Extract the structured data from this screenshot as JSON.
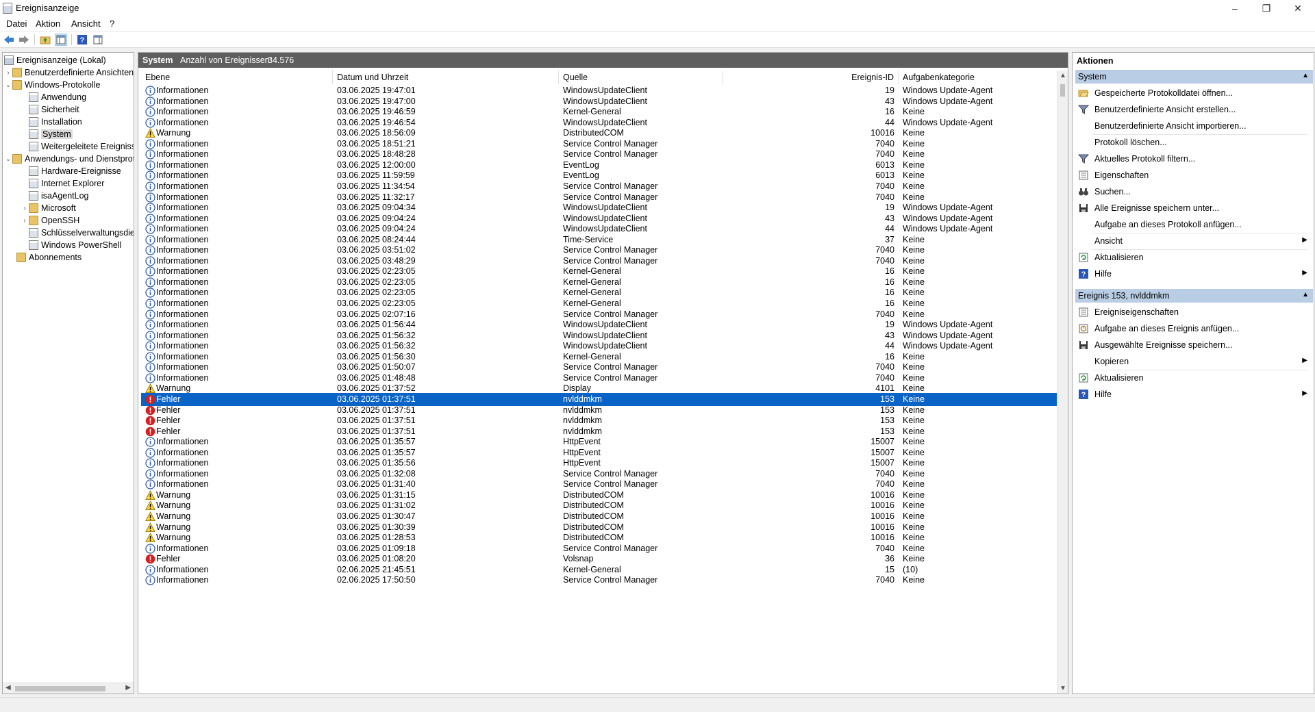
{
  "window": {
    "title": "Ereignisanzeige"
  },
  "menubar": [
    "Datei",
    "Aktion",
    "Ansicht",
    "?"
  ],
  "tree": {
    "root": "Ereignisanzeige (Lokal)",
    "custom_views": "Benutzerdefinierte Ansichten",
    "windows_logs": "Windows-Protokolle",
    "windows_logs_items": [
      "Anwendung",
      "Sicherheit",
      "Installation",
      "System",
      "Weitergeleitete Ereignisse"
    ],
    "apps_services": "Anwendungs- und Dienstprotokolle",
    "apps_items": [
      "Hardware-Ereignisse",
      "Internet Explorer",
      "isaAgentLog",
      "Microsoft",
      "OpenSSH",
      "Schlüsselverwaltungsdienst",
      "Windows PowerShell"
    ],
    "subscriptions": "Abonnements"
  },
  "center": {
    "log_name": "System",
    "count_label": "Anzahl von Ereignissen:",
    "count_value": "34.576",
    "columns": [
      "Ebene",
      "Datum und Uhrzeit",
      "Quelle",
      "Ereignis-ID",
      "Aufgabenkategorie"
    ],
    "rows": [
      {
        "level": "Informationen",
        "date": "03.06.2025 19:47:01",
        "source": "WindowsUpdateClient",
        "id": "19",
        "cat": "Windows Update-Agent"
      },
      {
        "level": "Informationen",
        "date": "03.06.2025 19:47:00",
        "source": "WindowsUpdateClient",
        "id": "43",
        "cat": "Windows Update-Agent"
      },
      {
        "level": "Informationen",
        "date": "03.06.2025 19:46:59",
        "source": "Kernel-General",
        "id": "16",
        "cat": "Keine"
      },
      {
        "level": "Informationen",
        "date": "03.06.2025 19:46:54",
        "source": "WindowsUpdateClient",
        "id": "44",
        "cat": "Windows Update-Agent"
      },
      {
        "level": "Warnung",
        "date": "03.06.2025 18:56:09",
        "source": "DistributedCOM",
        "id": "10016",
        "cat": "Keine"
      },
      {
        "level": "Informationen",
        "date": "03.06.2025 18:51:21",
        "source": "Service Control Manager",
        "id": "7040",
        "cat": "Keine"
      },
      {
        "level": "Informationen",
        "date": "03.06.2025 18:48:28",
        "source": "Service Control Manager",
        "id": "7040",
        "cat": "Keine"
      },
      {
        "level": "Informationen",
        "date": "03.06.2025 12:00:00",
        "source": "EventLog",
        "id": "6013",
        "cat": "Keine"
      },
      {
        "level": "Informationen",
        "date": "03.06.2025 11:59:59",
        "source": "EventLog",
        "id": "6013",
        "cat": "Keine"
      },
      {
        "level": "Informationen",
        "date": "03.06.2025 11:34:54",
        "source": "Service Control Manager",
        "id": "7040",
        "cat": "Keine"
      },
      {
        "level": "Informationen",
        "date": "03.06.2025 11:32:17",
        "source": "Service Control Manager",
        "id": "7040",
        "cat": "Keine"
      },
      {
        "level": "Informationen",
        "date": "03.06.2025 09:04:34",
        "source": "WindowsUpdateClient",
        "id": "19",
        "cat": "Windows Update-Agent"
      },
      {
        "level": "Informationen",
        "date": "03.06.2025 09:04:24",
        "source": "WindowsUpdateClient",
        "id": "43",
        "cat": "Windows Update-Agent"
      },
      {
        "level": "Informationen",
        "date": "03.06.2025 09:04:24",
        "source": "WindowsUpdateClient",
        "id": "44",
        "cat": "Windows Update-Agent"
      },
      {
        "level": "Informationen",
        "date": "03.06.2025 08:24:44",
        "source": "Time-Service",
        "id": "37",
        "cat": "Keine"
      },
      {
        "level": "Informationen",
        "date": "03.06.2025 03:51:02",
        "source": "Service Control Manager",
        "id": "7040",
        "cat": "Keine"
      },
      {
        "level": "Informationen",
        "date": "03.06.2025 03:48:29",
        "source": "Service Control Manager",
        "id": "7040",
        "cat": "Keine"
      },
      {
        "level": "Informationen",
        "date": "03.06.2025 02:23:05",
        "source": "Kernel-General",
        "id": "16",
        "cat": "Keine"
      },
      {
        "level": "Informationen",
        "date": "03.06.2025 02:23:05",
        "source": "Kernel-General",
        "id": "16",
        "cat": "Keine"
      },
      {
        "level": "Informationen",
        "date": "03.06.2025 02:23:05",
        "source": "Kernel-General",
        "id": "16",
        "cat": "Keine"
      },
      {
        "level": "Informationen",
        "date": "03.06.2025 02:23:05",
        "source": "Kernel-General",
        "id": "16",
        "cat": "Keine"
      },
      {
        "level": "Informationen",
        "date": "03.06.2025 02:07:16",
        "source": "Service Control Manager",
        "id": "7040",
        "cat": "Keine"
      },
      {
        "level": "Informationen",
        "date": "03.06.2025 01:56:44",
        "source": "WindowsUpdateClient",
        "id": "19",
        "cat": "Windows Update-Agent"
      },
      {
        "level": "Informationen",
        "date": "03.06.2025 01:56:32",
        "source": "WindowsUpdateClient",
        "id": "43",
        "cat": "Windows Update-Agent"
      },
      {
        "level": "Informationen",
        "date": "03.06.2025 01:56:32",
        "source": "WindowsUpdateClient",
        "id": "44",
        "cat": "Windows Update-Agent"
      },
      {
        "level": "Informationen",
        "date": "03.06.2025 01:56:30",
        "source": "Kernel-General",
        "id": "16",
        "cat": "Keine"
      },
      {
        "level": "Informationen",
        "date": "03.06.2025 01:50:07",
        "source": "Service Control Manager",
        "id": "7040",
        "cat": "Keine"
      },
      {
        "level": "Informationen",
        "date": "03.06.2025 01:48:48",
        "source": "Service Control Manager",
        "id": "7040",
        "cat": "Keine"
      },
      {
        "level": "Warnung",
        "date": "03.06.2025 01:37:52",
        "source": "Display",
        "id": "4101",
        "cat": "Keine"
      },
      {
        "level": "Fehler",
        "date": "03.06.2025 01:37:51",
        "source": "nvlddmkm",
        "id": "153",
        "cat": "Keine",
        "selected": true
      },
      {
        "level": "Fehler",
        "date": "03.06.2025 01:37:51",
        "source": "nvlddmkm",
        "id": "153",
        "cat": "Keine"
      },
      {
        "level": "Fehler",
        "date": "03.06.2025 01:37:51",
        "source": "nvlddmkm",
        "id": "153",
        "cat": "Keine"
      },
      {
        "level": "Fehler",
        "date": "03.06.2025 01:37:51",
        "source": "nvlddmkm",
        "id": "153",
        "cat": "Keine"
      },
      {
        "level": "Informationen",
        "date": "03.06.2025 01:35:57",
        "source": "HttpEvent",
        "id": "15007",
        "cat": "Keine"
      },
      {
        "level": "Informationen",
        "date": "03.06.2025 01:35:57",
        "source": "HttpEvent",
        "id": "15007",
        "cat": "Keine"
      },
      {
        "level": "Informationen",
        "date": "03.06.2025 01:35:56",
        "source": "HttpEvent",
        "id": "15007",
        "cat": "Keine"
      },
      {
        "level": "Informationen",
        "date": "03.06.2025 01:32:08",
        "source": "Service Control Manager",
        "id": "7040",
        "cat": "Keine"
      },
      {
        "level": "Informationen",
        "date": "03.06.2025 01:31:40",
        "source": "Service Control Manager",
        "id": "7040",
        "cat": "Keine"
      },
      {
        "level": "Warnung",
        "date": "03.06.2025 01:31:15",
        "source": "DistributedCOM",
        "id": "10016",
        "cat": "Keine"
      },
      {
        "level": "Warnung",
        "date": "03.06.2025 01:31:02",
        "source": "DistributedCOM",
        "id": "10016",
        "cat": "Keine"
      },
      {
        "level": "Warnung",
        "date": "03.06.2025 01:30:47",
        "source": "DistributedCOM",
        "id": "10016",
        "cat": "Keine"
      },
      {
        "level": "Warnung",
        "date": "03.06.2025 01:30:39",
        "source": "DistributedCOM",
        "id": "10016",
        "cat": "Keine"
      },
      {
        "level": "Warnung",
        "date": "03.06.2025 01:28:53",
        "source": "DistributedCOM",
        "id": "10016",
        "cat": "Keine"
      },
      {
        "level": "Informationen",
        "date": "03.06.2025 01:09:18",
        "source": "Service Control Manager",
        "id": "7040",
        "cat": "Keine"
      },
      {
        "level": "Fehler",
        "date": "03.06.2025 01:08:20",
        "source": "Volsnap",
        "id": "36",
        "cat": "Keine"
      },
      {
        "level": "Informationen",
        "date": "02.06.2025 21:45:51",
        "source": "Kernel-General",
        "id": "15",
        "cat": "(10)"
      },
      {
        "level": "Informationen",
        "date": "02.06.2025 17:50:50",
        "source": "Service Control Manager",
        "id": "7040",
        "cat": "Keine"
      }
    ]
  },
  "actions": {
    "title": "Aktionen",
    "section1": "System",
    "section1_items": [
      {
        "label": "Gespeicherte Protokolldatei öffnen...",
        "icon": "folder-open-icon"
      },
      {
        "label": "Benutzerdefinierte Ansicht erstellen...",
        "icon": "filter-icon"
      },
      {
        "label": "Benutzerdefinierte Ansicht importieren...",
        "icon": ""
      },
      {
        "label": "Protokoll löschen...",
        "icon": ""
      },
      {
        "label": "Aktuelles Protokoll filtern...",
        "icon": "filter-icon"
      },
      {
        "label": "Eigenschaften",
        "icon": "properties-icon"
      },
      {
        "label": "Suchen...",
        "icon": "binoculars-icon"
      },
      {
        "label": "Alle Ereignisse speichern unter...",
        "icon": "save-icon"
      },
      {
        "label": "Aufgabe an dieses Protokoll anfügen...",
        "icon": ""
      },
      {
        "label": "Ansicht",
        "icon": "",
        "submenu": true
      },
      {
        "label": "Aktualisieren",
        "icon": "refresh-icon"
      },
      {
        "label": "Hilfe",
        "icon": "help-icon",
        "submenu": true
      }
    ],
    "section2": "Ereignis 153, nvlddmkm",
    "section2_items": [
      {
        "label": "Ereigniseigenschaften",
        "icon": "properties-icon"
      },
      {
        "label": "Aufgabe an dieses Ereignis anfügen...",
        "icon": "task-icon"
      },
      {
        "label": "Ausgewählte Ereignisse speichern...",
        "icon": "save-icon"
      },
      {
        "label": "Kopieren",
        "icon": "",
        "submenu": true
      },
      {
        "label": "Aktualisieren",
        "icon": "refresh-icon"
      },
      {
        "label": "Hilfe",
        "icon": "help-icon",
        "submenu": true
      }
    ]
  },
  "colors": {
    "selection": "#0a64c8",
    "header": "#5f5f5f",
    "section": "#b9cde4"
  }
}
